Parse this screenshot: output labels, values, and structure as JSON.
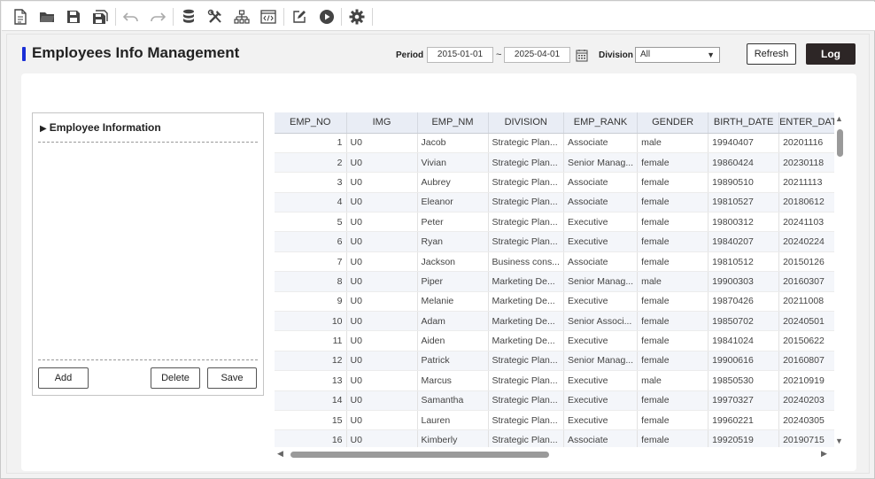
{
  "toolbar": {
    "icons": [
      "new-file-icon",
      "open-folder-icon",
      "save-icon",
      "save-all-icon",
      "undo-icon",
      "redo-icon",
      "database-icon",
      "build-tools-icon",
      "hierarchy-icon",
      "code-view-icon",
      "edit-icon",
      "run-icon",
      "settings-icon"
    ]
  },
  "header": {
    "title": "Employees Info Management",
    "period_label": "Period",
    "date_from": "2015-01-01",
    "date_sep": "~",
    "date_to": "2025-04-01",
    "division_label": "Division",
    "division_value": "All",
    "refresh_label": "Refresh",
    "log_label": "Log"
  },
  "panel": {
    "title": "Employee Information",
    "add_label": "Add",
    "delete_label": "Delete",
    "save_label": "Save"
  },
  "grid": {
    "columns": [
      "EMP_NO",
      "IMG",
      "EMP_NM",
      "DIVISION",
      "EMP_RANK",
      "GENDER",
      "BIRTH_DATE",
      "ENTER_DATE"
    ],
    "rows": [
      [
        "1",
        "U0",
        "Jacob",
        "Strategic Plan...",
        "Associate",
        "male",
        "19940407",
        "20201116"
      ],
      [
        "2",
        "U0",
        "Vivian",
        "Strategic Plan...",
        "Senior Manag...",
        "female",
        "19860424",
        "20230118"
      ],
      [
        "3",
        "U0",
        "Aubrey",
        "Strategic Plan...",
        "Associate",
        "female",
        "19890510",
        "20211113"
      ],
      [
        "4",
        "U0",
        "Eleanor",
        "Strategic Plan...",
        "Associate",
        "female",
        "19810527",
        "20180612"
      ],
      [
        "5",
        "U0",
        "Peter",
        "Strategic Plan...",
        "Executive",
        "female",
        "19800312",
        "20241103"
      ],
      [
        "6",
        "U0",
        "Ryan",
        "Strategic Plan...",
        "Executive",
        "female",
        "19840207",
        "20240224"
      ],
      [
        "7",
        "U0",
        "Jackson",
        "Business cons...",
        "Associate",
        "female",
        "19810512",
        "20150126"
      ],
      [
        "8",
        "U0",
        "Piper",
        "Marketing De...",
        "Senior Manag...",
        "male",
        "19900303",
        "20160307"
      ],
      [
        "9",
        "U0",
        "Melanie",
        "Marketing De...",
        "Executive",
        "female",
        "19870426",
        "20211008"
      ],
      [
        "10",
        "U0",
        "Adam",
        "Marketing De...",
        "Senior Associ...",
        "female",
        "19850702",
        "20240501"
      ],
      [
        "11",
        "U0",
        "Aiden",
        "Marketing De...",
        "Executive",
        "female",
        "19841024",
        "20150622"
      ],
      [
        "12",
        "U0",
        "Patrick",
        "Strategic Plan...",
        "Senior Manag...",
        "female",
        "19900616",
        "20160807"
      ],
      [
        "13",
        "U0",
        "Marcus",
        "Strategic Plan...",
        "Executive",
        "male",
        "19850530",
        "20210919"
      ],
      [
        "14",
        "U0",
        "Samantha",
        "Strategic Plan...",
        "Executive",
        "female",
        "19970327",
        "20240203"
      ],
      [
        "15",
        "U0",
        "Lauren",
        "Strategic Plan...",
        "Executive",
        "female",
        "19960221",
        "20240305"
      ],
      [
        "16",
        "U0",
        "Kimberly",
        "Strategic Plan...",
        "Associate",
        "female",
        "19920519",
        "20190715"
      ]
    ]
  }
}
